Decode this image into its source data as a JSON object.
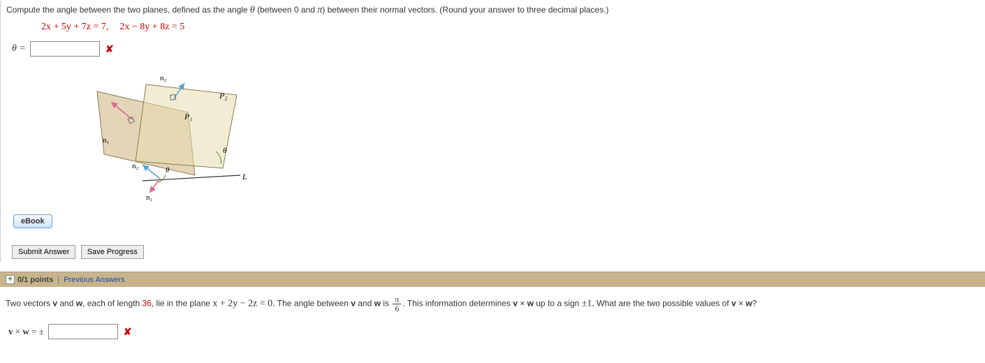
{
  "q1": {
    "prompt_pre": "Compute the angle between the two planes, defined as the angle ",
    "theta": "θ",
    "prompt_mid": " (between 0 and ",
    "pi": "π",
    "prompt_post": ") between their normal vectors. (Round your answer to three decimal places.)",
    "eq1": "2x + 5y + 7z = 7,",
    "eq2": "2x − 8y + 8z = 5",
    "theta_equals": "θ =",
    "answer_value": ""
  },
  "figure": {
    "n1_top": "n₁",
    "n2_top": "n₂",
    "P1": "P₁",
    "P2": "P₂",
    "n1_bot": "n₁",
    "n2_bot": "n₂",
    "theta1": "θ",
    "theta2": "θ",
    "L": "L"
  },
  "buttons": {
    "ebook": "eBook",
    "submit": "Submit Answer",
    "save": "Save Progress"
  },
  "bar": {
    "points": "0/1 points",
    "prev": "Previous Answers"
  },
  "q2": {
    "t1": "Two vectors ",
    "v": "v",
    "t2": " and ",
    "w": "w",
    "t3": ", each of length ",
    "len": "36",
    "t4": ", lie in the plane ",
    "plane": "x + 2y − 2z = 0.",
    "t5": "  The angle between ",
    "t6": " is ",
    "frac_num": "π",
    "frac_den": "6",
    "t7": ". This information determines ",
    "t8": " up to a sign ",
    "pm1": "±1.",
    "t9": " What are the two possible values of ",
    "qmark": "?",
    "cross_label": "v × w = ±",
    "answer2_value": ""
  },
  "icons": {
    "wrong": "✘",
    "plus": "+"
  }
}
